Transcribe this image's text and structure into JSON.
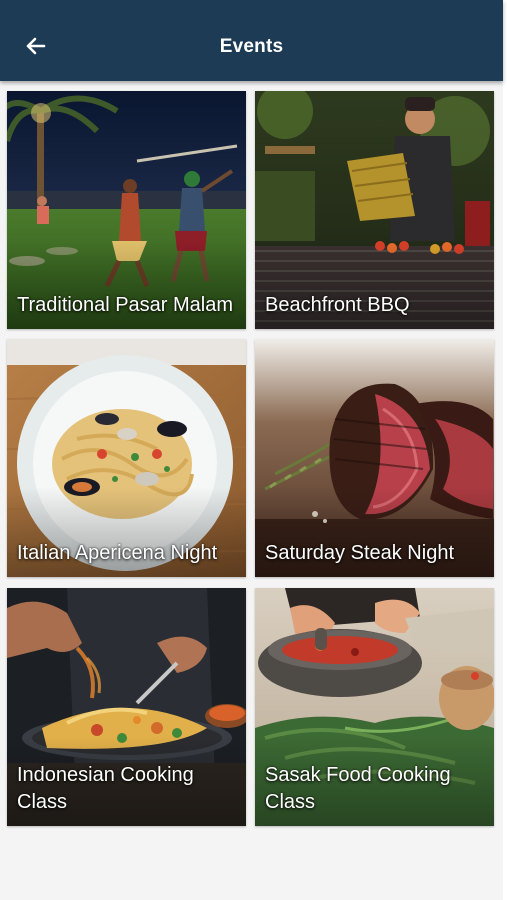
{
  "header": {
    "title": "Events",
    "back_icon": "arrow-left-icon",
    "background_color": "#1e3b55"
  },
  "events": [
    {
      "title": "Traditional Pasar Malam"
    },
    {
      "title": "Beachfront BBQ"
    },
    {
      "title": "Italian Apericena Night"
    },
    {
      "title": "Saturday Steak Night"
    },
    {
      "title": "Indonesian Cooking Class"
    },
    {
      "title": "Sasak Food Cooking Class"
    }
  ]
}
